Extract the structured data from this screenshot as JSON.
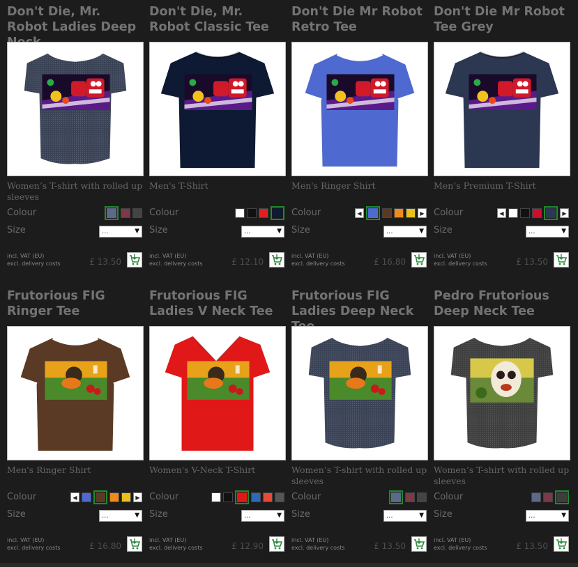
{
  "products": [
    {
      "title": "Don't Die, Mr. Robot Ladies Deep Neck",
      "type": "Women’s T-shirt with rolled up sleeves",
      "colour_label": "Colour",
      "size_label": "Size",
      "size_value": "...",
      "vat_line1": "incl. VAT (EU)",
      "vat_line2": "excl. delivery costs",
      "price": "£ 13.50",
      "shirt_color": "#3a4256",
      "shirt_style": "deep",
      "art": "robot",
      "arrows": false,
      "swatches": [
        {
          "color": "#5a6a88",
          "selected": true
        },
        {
          "color": "#7a3a48",
          "selected": false
        },
        {
          "color": "#444444",
          "selected": false
        }
      ]
    },
    {
      "title": "Don't Die, Mr. Robot Classic Tee",
      "type": "Men's T-Shirt",
      "colour_label": "Colour",
      "size_label": "Size",
      "size_value": "...",
      "vat_line1": "incl. VAT (EU)",
      "vat_line2": "excl. delivery costs",
      "price": "£ 12.10",
      "shirt_color": "#0e1a33",
      "shirt_style": "classic",
      "art": "robot",
      "arrows": false,
      "swatches": [
        {
          "color": "#ffffff",
          "selected": false
        },
        {
          "color": "#111111",
          "selected": false
        },
        {
          "color": "#e02020",
          "selected": false
        },
        {
          "color": "#0e1a33",
          "selected": true
        }
      ]
    },
    {
      "title": "Don't Die Mr Robot Retro Tee",
      "type": "Men's Ringer Shirt",
      "colour_label": "Colour",
      "size_label": "Size",
      "size_value": "...",
      "vat_line1": "incl. VAT (EU)",
      "vat_line2": "excl. delivery costs",
      "price": "£ 16.80",
      "shirt_color": "#4e6ad0",
      "shirt_style": "ringer",
      "trim_color": "#ffffff",
      "art": "robot",
      "arrows": true,
      "swatches": [
        {
          "color": "#4e6ad0",
          "selected": true
        },
        {
          "color": "#5a3a22",
          "selected": false
        },
        {
          "color": "#f08a1a",
          "selected": false
        },
        {
          "color": "#e8c21a",
          "selected": false
        }
      ]
    },
    {
      "title": "Don't Die Mr Robot Tee Grey",
      "type": "Men’s Premium T-Shirt",
      "colour_label": "Colour",
      "size_label": "Size",
      "size_value": "...",
      "vat_line1": "incl. VAT (EU)",
      "vat_line2": "excl. delivery costs",
      "price": "£ 13.50",
      "shirt_color": "#2c3752",
      "shirt_style": "classic",
      "art": "robot",
      "arrows": true,
      "swatches": [
        {
          "color": "#ffffff",
          "selected": false
        },
        {
          "color": "#111111",
          "selected": false
        },
        {
          "color": "#c8102e",
          "selected": false
        },
        {
          "color": "#2c3752",
          "selected": true
        }
      ]
    },
    {
      "title": "Frutorious FIG Ringer Tee",
      "type": "Men's Ringer Shirt",
      "colour_label": "Colour",
      "size_label": "Size",
      "size_value": "...",
      "vat_line1": "incl. VAT (EU)",
      "vat_line2": "excl. delivery costs",
      "price": "£ 16.80",
      "shirt_color": "#5a3a24",
      "shirt_style": "ringer",
      "trim_color": "#ffffff",
      "art": "fig",
      "arrows": true,
      "swatches": [
        {
          "color": "#4e6ad0",
          "selected": false
        },
        {
          "color": "#5a3a24",
          "selected": true
        },
        {
          "color": "#f08a1a",
          "selected": false
        },
        {
          "color": "#e8c21a",
          "selected": false
        }
      ]
    },
    {
      "title": "Frutorious FIG Ladies V Neck Tee",
      "type": "Women's V-Neck T-Shirt",
      "colour_label": "Colour",
      "size_label": "Size",
      "size_value": "...",
      "vat_line1": "incl. VAT (EU)",
      "vat_line2": "excl. delivery costs",
      "price": "£ 12.90",
      "shirt_color": "#e01818",
      "shirt_style": "vneck",
      "art": "fig",
      "arrows": false,
      "swatches": [
        {
          "color": "#ffffff",
          "selected": false
        },
        {
          "color": "#111111",
          "selected": false
        },
        {
          "color": "#e01818",
          "selected": true
        },
        {
          "color": "#2a6ab8",
          "selected": false
        },
        {
          "color": "#e84a3a",
          "selected": false
        },
        {
          "color": "#555555",
          "selected": false
        }
      ]
    },
    {
      "title": "Frutorious FIG Ladies Deep Neck Tee",
      "type": "Women’s T-shirt with rolled up sleeves",
      "colour_label": "Colour",
      "size_label": "Size",
      "size_value": "...",
      "vat_line1": "incl. VAT (EU)",
      "vat_line2": "excl. delivery costs",
      "price": "£ 13.50",
      "shirt_color": "#3a4256",
      "shirt_style": "deep",
      "art": "fig",
      "arrows": false,
      "swatches": [
        {
          "color": "#5a6a88",
          "selected": true
        },
        {
          "color": "#7a3a48",
          "selected": false
        },
        {
          "color": "#444444",
          "selected": false
        }
      ]
    },
    {
      "title": "Pedro Frutorious Deep Neck Tee",
      "type": "Women’s T-shirt with rolled up sleeves",
      "colour_label": "Colour",
      "size_label": "Size",
      "size_value": "...",
      "vat_line1": "incl. VAT (EU)",
      "vat_line2": "excl. delivery costs",
      "price": "£ 13.50",
      "shirt_color": "#3e3e3e",
      "shirt_style": "deep",
      "art": "pedro",
      "arrows": false,
      "swatches": [
        {
          "color": "#5a6a88",
          "selected": false
        },
        {
          "color": "#7a3a48",
          "selected": false
        },
        {
          "color": "#3e3e3e",
          "selected": true
        }
      ]
    }
  ],
  "icons": {
    "cart": "shopping-cart-icon",
    "arrow_left": "◀",
    "arrow_right": "▶",
    "select_caret": "▼"
  },
  "colors": {
    "background": "#1c1c1c",
    "selected_border": "#1f8a2e",
    "title_text": "#737373"
  }
}
